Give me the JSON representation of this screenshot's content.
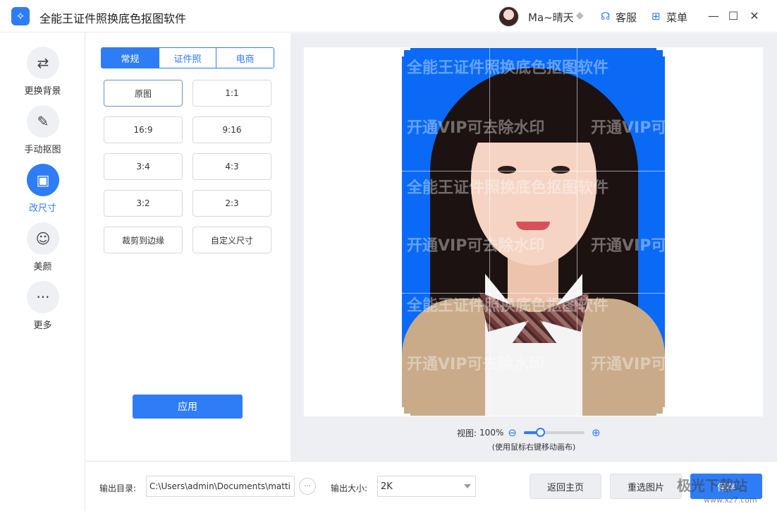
{
  "app": {
    "title": "全能王证件照换底色抠图软件",
    "logo_glyph": "✧"
  },
  "user": {
    "name": "Ma~晴天",
    "vip_icon": "diamond-icon"
  },
  "header": {
    "service_label": "客服",
    "menu_label": "菜单"
  },
  "window": {
    "minimize": "—",
    "maximize": "☐",
    "close": "✕"
  },
  "sidebar": {
    "items": [
      {
        "label": "更换背景",
        "icon": "⇄"
      },
      {
        "label": "手动抠图",
        "icon": "✎"
      },
      {
        "label": "改尺寸",
        "icon": "▣"
      },
      {
        "label": "美颜",
        "icon": "☺"
      },
      {
        "label": "更多",
        "icon": "···"
      }
    ],
    "active_index": 2
  },
  "panel": {
    "tabs": [
      "常规",
      "证件照",
      "电商"
    ],
    "active_tab": 0,
    "ratios": [
      "原图",
      "1:1",
      "16:9",
      "9:16",
      "3:4",
      "4:3",
      "3:2",
      "2:3",
      "裁剪到边缘",
      "自定义尺寸"
    ],
    "selected_ratio": 0,
    "apply_label": "应用"
  },
  "canvas": {
    "watermark_texts": [
      "全能王证件照换底色抠图软件",
      "开通VIP可去除水印"
    ],
    "background_color": "#0a6af5"
  },
  "zoom": {
    "label": "视图:",
    "value": "100%",
    "level_fraction": 0.27,
    "hint": "(使用鼠标右键移动画布)"
  },
  "bottom": {
    "output_dir_label": "输出目录:",
    "output_dir_value": "C:\\Users\\admin\\Documents\\matting",
    "browse_glyph": "···",
    "output_size_label": "输出大小:",
    "output_size_value": "2K",
    "back_home_label": "返回主页",
    "reselect_label": "重选图片",
    "save_label": "保存"
  },
  "site_watermark": {
    "logo": "极光下载站",
    "url": "www.xz7.com"
  },
  "colors": {
    "accent": "#2f7df6"
  }
}
